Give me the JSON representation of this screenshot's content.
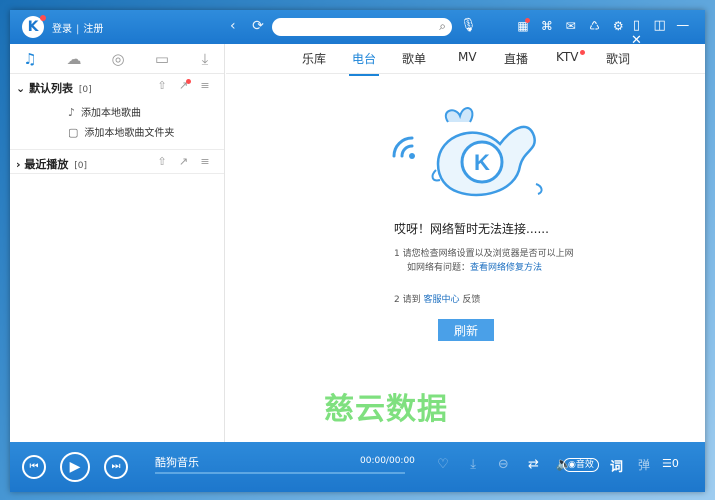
{
  "titlebar": {
    "logo": "K",
    "login": "登录",
    "register": "注册",
    "back_icon": "chevron-left-icon",
    "refresh_icon": "refresh-icon",
    "search_placeholder": "",
    "icons": [
      "skin-grid-icon",
      "game-icon",
      "mail-icon",
      "shirt-icon",
      "gear-icon"
    ],
    "window_controls": [
      "mini-player-icon",
      "sidebar-icon",
      "minimize-icon",
      "close-icon"
    ]
  },
  "left_tabs": [
    "music-note-icon",
    "cloud-icon",
    "radio-icon",
    "device-icon",
    "download-icon"
  ],
  "playlists": {
    "default": {
      "title": "默认列表",
      "count": "[0]"
    },
    "add_song": "添加本地歌曲",
    "add_folder": "添加本地歌曲文件夹",
    "recent": {
      "title": "最近播放",
      "count": "[0]"
    }
  },
  "tabs": [
    {
      "label": "乐库"
    },
    {
      "label": "电台"
    },
    {
      "label": "歌单"
    },
    {
      "label": "MV"
    },
    {
      "label": "直播"
    },
    {
      "label": "KTV"
    },
    {
      "label": "歌词"
    }
  ],
  "active_tab": "电台",
  "error": {
    "title": "哎呀！网络暂时无法连接......",
    "line1": "1  请您检查网络设置以及浏览器是否可以上网",
    "line2_prefix": "如网络有问题：",
    "line2_link": "查看网络修复方法",
    "line3_prefix": "2  请到",
    "line3_link": "客服中心",
    "line3_suffix": "反馈",
    "refresh_label": "刷新"
  },
  "watermark": "慈云数据",
  "player": {
    "song": "酷狗音乐",
    "time": "00:00/00:00",
    "progress": 0,
    "sound_badge": "◉音效",
    "lyric": "词",
    "danmu": "弹",
    "queue_count": "0"
  },
  "colors": {
    "accent": "#1c84d8",
    "titlebar": "#1c78cf",
    "badge": "#ff4d4f"
  }
}
